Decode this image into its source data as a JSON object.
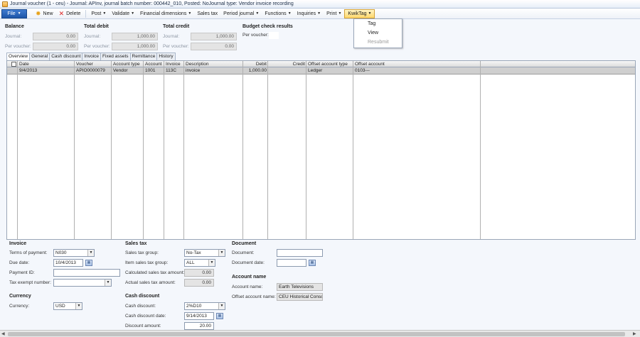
{
  "window": {
    "title": "Journal voucher (1 - ceu) - Journal: APInv, journal batch number: 000442_010, Posted: NoJournal type: Vendor invoice recording"
  },
  "toolbar": {
    "file": "File",
    "new": "New",
    "delete": "Delete",
    "post": "Post",
    "validate": "Validate",
    "financial_dimensions": "Financial dimensions",
    "sales_tax": "Sales tax",
    "period_journal": "Period journal",
    "functions": "Functions",
    "inquiries": "Inquiries",
    "print": "Print",
    "kwiktag": "KwikTag"
  },
  "kwiktag_menu": {
    "items": [
      {
        "label": "Tag",
        "enabled": true
      },
      {
        "label": "View",
        "enabled": true
      },
      {
        "label": "Resubmit",
        "enabled": false
      }
    ]
  },
  "summary": {
    "balance": {
      "title": "Balance",
      "journal_label": "Journal:",
      "journal_value": "0.00",
      "voucher_label": "Per voucher:",
      "voucher_value": "0.00"
    },
    "total_debit": {
      "title": "Total debit",
      "journal_label": "Journal:",
      "journal_value": "1,000.00",
      "voucher_label": "Per voucher:",
      "voucher_value": "1,000.00"
    },
    "total_credit": {
      "title": "Total credit",
      "journal_label": "Journal:",
      "journal_value": "1,000.00",
      "voucher_label": "Per voucher:",
      "voucher_value": "0.00"
    },
    "budget": {
      "title": "Budget check results",
      "voucher_label": "Per voucher:"
    }
  },
  "tabs": [
    "Overview",
    "General",
    "Cash discount",
    "Invoice",
    "Fixed assets",
    "Remittance",
    "History"
  ],
  "grid": {
    "columns": [
      "Date",
      "Voucher",
      "Account type",
      "Account",
      "Invoice",
      "Description",
      "Debit",
      "Credit",
      "Offset account type",
      "Offset account"
    ],
    "rows": [
      [
        "9/4/2013",
        "APIO0000079",
        "Vendor",
        "1001",
        "113C",
        "invoice",
        "1,000.00",
        "",
        "Ledger",
        "0103---"
      ]
    ]
  },
  "invoice": {
    "title": "Invoice",
    "terms_label": "Terms of payment:",
    "terms_value": "N030",
    "due_label": "Due date:",
    "due_value": "10/4/2013",
    "payment_id_label": "Payment ID:",
    "payment_id_value": "",
    "tax_exempt_label": "Tax exempt number:",
    "tax_exempt_value": ""
  },
  "currency": {
    "title": "Currency",
    "label": "Currency:",
    "value": "USD"
  },
  "sales_tax": {
    "title": "Sales tax",
    "group_label": "Sales tax group:",
    "group_value": "No-Tax",
    "item_group_label": "Item sales tax group:",
    "item_group_value": "ALL",
    "calculated_label": "Calculated sales tax amount:",
    "calculated_value": "0.00",
    "actual_label": "Actual sales tax amount:",
    "actual_value": "0.00"
  },
  "cash_discount": {
    "title": "Cash discount",
    "discount_label": "Cash discount:",
    "discount_value": "2%D10",
    "date_label": "Cash discount date:",
    "date_value": "9/14/2013",
    "amount_label": "Discount amount:",
    "amount_value": "20.00"
  },
  "document": {
    "title": "Document",
    "doc_label": "Document:",
    "doc_value": "",
    "date_label": "Document date:",
    "date_value": ""
  },
  "account_name": {
    "title": "Account name",
    "name_label": "Account name:",
    "name_value": "Earth Televisions",
    "offset_label": "Offset account name:",
    "offset_value": "CEU Historical Consol"
  }
}
